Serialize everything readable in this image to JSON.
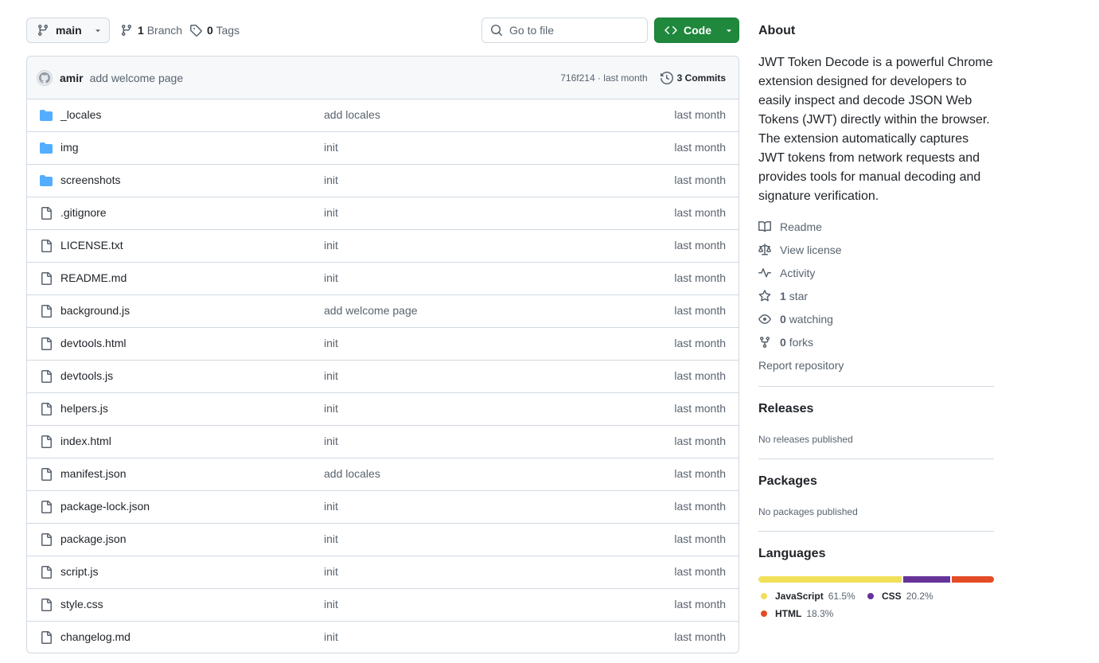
{
  "toolbar": {
    "branch": "main",
    "branches_count": "1",
    "branches_label": "Branch",
    "tags_count": "0",
    "tags_label": "Tags",
    "goto_placeholder": "Go to file",
    "code_label": "Code"
  },
  "commit": {
    "author": "amir",
    "message": "add welcome page",
    "hash_time": "716f214 · last month",
    "commits_label": "3 Commits"
  },
  "files": [
    {
      "name": "_locales",
      "type": "dir",
      "message": "add locales",
      "time": "last month"
    },
    {
      "name": "img",
      "type": "dir",
      "message": "init",
      "time": "last month"
    },
    {
      "name": "screenshots",
      "type": "dir",
      "message": "init",
      "time": "last month"
    },
    {
      "name": ".gitignore",
      "type": "file",
      "message": "init",
      "time": "last month"
    },
    {
      "name": "LICENSE.txt",
      "type": "file",
      "message": "init",
      "time": "last month"
    },
    {
      "name": "README.md",
      "type": "file",
      "message": "init",
      "time": "last month"
    },
    {
      "name": "background.js",
      "type": "file",
      "message": "add welcome page",
      "time": "last month"
    },
    {
      "name": "devtools.html",
      "type": "file",
      "message": "init",
      "time": "last month"
    },
    {
      "name": "devtools.js",
      "type": "file",
      "message": "init",
      "time": "last month"
    },
    {
      "name": "helpers.js",
      "type": "file",
      "message": "init",
      "time": "last month"
    },
    {
      "name": "index.html",
      "type": "file",
      "message": "init",
      "time": "last month"
    },
    {
      "name": "manifest.json",
      "type": "file",
      "message": "add locales",
      "time": "last month"
    },
    {
      "name": "package-lock.json",
      "type": "file",
      "message": "init",
      "time": "last month"
    },
    {
      "name": "package.json",
      "type": "file",
      "message": "init",
      "time": "last month"
    },
    {
      "name": "script.js",
      "type": "file",
      "message": "init",
      "time": "last month"
    },
    {
      "name": "style.css",
      "type": "file",
      "message": "init",
      "time": "last month"
    },
    {
      "name": "changelog.md",
      "type": "file",
      "message": "init",
      "time": "last month"
    }
  ],
  "about": {
    "heading": "About",
    "description": "JWT Token Decode is a powerful Chrome extension designed for developers to easily inspect and decode JSON Web Tokens (JWT) directly within the browser. The extension automatically captures JWT tokens from network requests and provides tools for manual decoding and signature verification.",
    "readme": "Readme",
    "license": "View license",
    "activity": "Activity",
    "stars_count": "1",
    "stars_label": "star",
    "watching_count": "0",
    "watching_label": "watching",
    "forks_count": "0",
    "forks_label": "forks",
    "report": "Report repository"
  },
  "releases": {
    "heading": "Releases",
    "empty": "No releases published"
  },
  "packages": {
    "heading": "Packages",
    "empty": "No packages published"
  },
  "languages": {
    "heading": "Languages",
    "items": [
      {
        "name": "JavaScript",
        "percent": "61.5%",
        "value": 61.5,
        "color": "#f1e05a"
      },
      {
        "name": "CSS",
        "percent": "20.2%",
        "value": 20.2,
        "color": "#663399"
      },
      {
        "name": "HTML",
        "percent": "18.3%",
        "value": 18.3,
        "color": "#e34c26"
      }
    ]
  },
  "colors": {
    "accent_green": "#1f883d",
    "folder_blue": "#54aeff",
    "muted": "#59636e"
  }
}
